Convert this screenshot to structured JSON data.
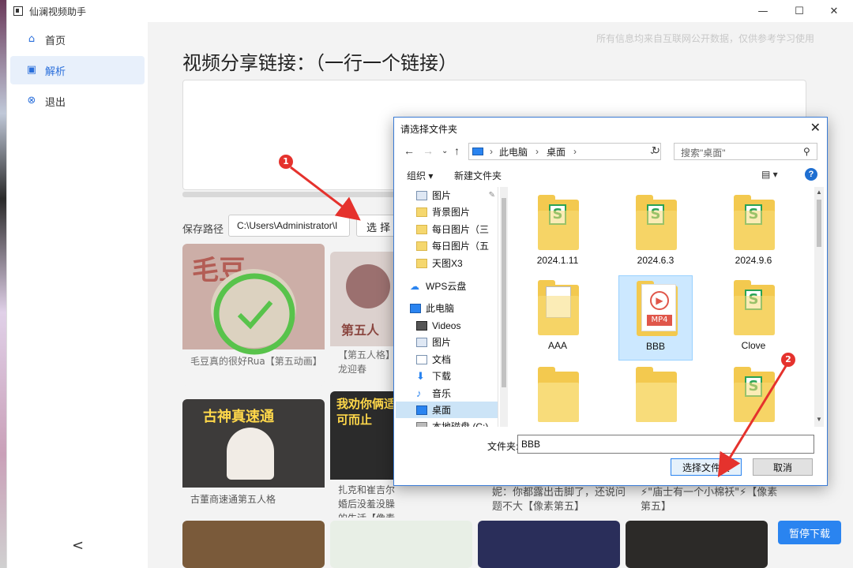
{
  "window": {
    "title": "仙澜视频助手"
  },
  "sidebar": {
    "items": [
      {
        "label": "首页",
        "icon": "home-icon"
      },
      {
        "label": "解析",
        "icon": "parse-icon"
      },
      {
        "label": "退出",
        "icon": "exit-icon"
      }
    ],
    "active_index": 1,
    "collapse": "<"
  },
  "main": {
    "disclaimer": "所有信息均来自互联网公开数据，仅供参考学习使用",
    "heading": "视频分享链接：（一行一个链接）",
    "save_label": "保存路径",
    "save_path": "C:\\Users\\Administrator\\I",
    "choose_button": "选 择",
    "pause_button": "暂停下载",
    "cards": [
      {
        "caption": "毛豆真的很好Rua【第五动画】",
        "thumb_text": "毛豆"
      },
      {
        "caption": "【第五人格】龙迎春",
        "thumb_text": "第五人"
      },
      {
        "caption": "古董商速通第五人格",
        "thumb_text": "古神真速通"
      },
      {
        "caption": "扎克和崔吉尔婚后没羞没臊的生活【像素第五】",
        "thumb_text": "我劝你俩适可而止"
      },
      {
        "caption": "妮：你都露出击脚了，还说问题不大【像素第五】"
      },
      {
        "caption": "⚡\"庙士有一个小棉袄\"⚡【像素第五】"
      }
    ]
  },
  "dialog": {
    "title": "请选择文件夹",
    "address": {
      "root": "此电脑",
      "current": "桌面"
    },
    "search_placeholder": "搜索\"桌面\"",
    "organize": "组织 ▾",
    "new_folder": "新建文件夹",
    "help": "?",
    "tree": [
      {
        "label": "图片",
        "icon": "image",
        "pinned": true
      },
      {
        "label": "背景图片",
        "icon": "folder"
      },
      {
        "label": "每日图片（三",
        "icon": "folder"
      },
      {
        "label": "每日图片（五",
        "icon": "folder"
      },
      {
        "label": "天图X3",
        "icon": "folder"
      },
      {
        "label": "WPS云盘",
        "icon": "cloud"
      },
      {
        "label": "此电脑",
        "icon": "pc"
      },
      {
        "label": "Videos",
        "icon": "video"
      },
      {
        "label": "图片",
        "icon": "image"
      },
      {
        "label": "文档",
        "icon": "doc"
      },
      {
        "label": "下载",
        "icon": "download"
      },
      {
        "label": "音乐",
        "icon": "music"
      },
      {
        "label": "桌面",
        "icon": "desktop",
        "selected": true
      },
      {
        "label": "本地磁盘 (C:)",
        "icon": "disk"
      }
    ],
    "files": [
      {
        "name": "2024.1.11",
        "type": "wps-folder"
      },
      {
        "name": "2024.6.3",
        "type": "wps-folder"
      },
      {
        "name": "2024.9.6",
        "type": "wps-folder"
      },
      {
        "name": "AAA",
        "type": "doc-folder"
      },
      {
        "name": "BBB",
        "type": "mp4-folder",
        "selected": true
      },
      {
        "name": "Clove",
        "type": "wps-folder"
      },
      {
        "name": "",
        "type": "folder"
      },
      {
        "name": "",
        "type": "folder"
      },
      {
        "name": "",
        "type": "wps-folder"
      }
    ],
    "folder_label": "文件夹:",
    "folder_value": "BBB",
    "ok_button": "选择文件夹",
    "cancel_button": "取消"
  },
  "annotations": [
    {
      "label": "1"
    },
    {
      "label": "2"
    }
  ],
  "colors": {
    "accent": "#2a84f0",
    "annotation_red": "#e5322d",
    "wps_green": "#29a355"
  }
}
